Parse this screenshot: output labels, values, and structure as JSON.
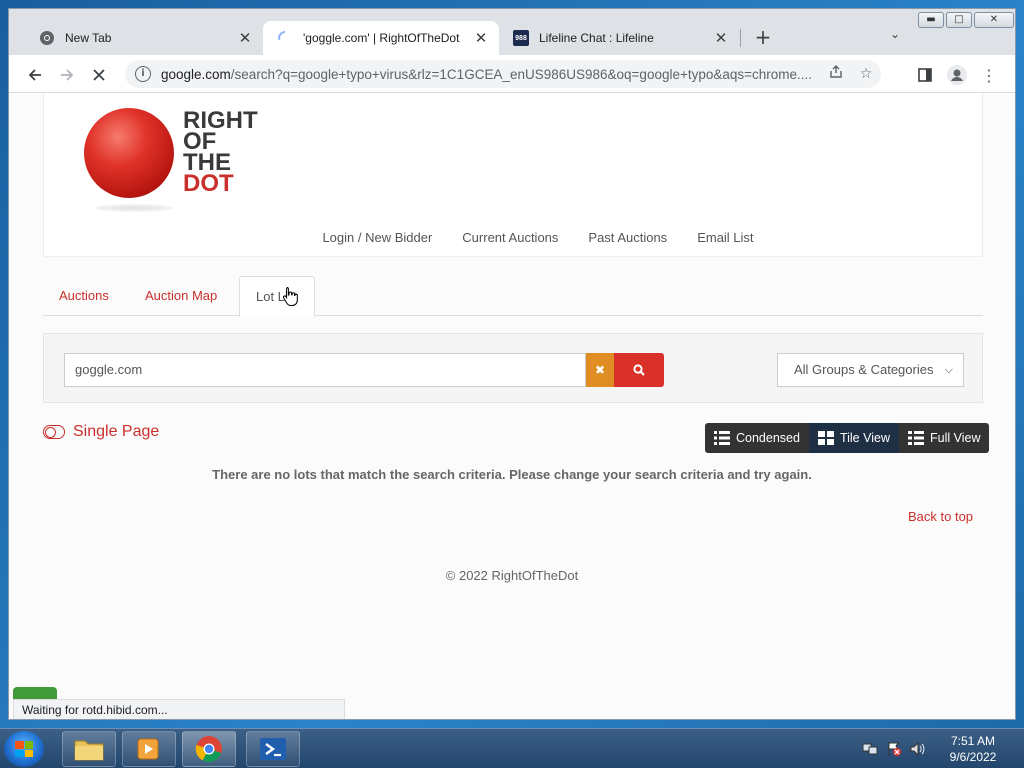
{
  "browser": {
    "tabs": [
      {
        "title": "New Tab",
        "icon": "chrome-icon",
        "active": false
      },
      {
        "title": "'goggle.com' | RightOfTheDot",
        "icon": "loading-spinner-icon",
        "active": true
      },
      {
        "title": "Lifeline Chat : Lifeline",
        "icon": "988-favicon",
        "favicon_text": "988",
        "active": false
      }
    ],
    "url_host": "google.com",
    "url_rest": "/search?q=google+typo+virus&rlz=1C1GCEA_enUS986US986&oq=google+typo&aqs=chrome....",
    "status_text": "Waiting for rotd.hibid.com..."
  },
  "site": {
    "logo_lines": [
      "RIGHT",
      "OF",
      "THE",
      "DOT"
    ],
    "nav": [
      "Login / New Bidder",
      "Current Auctions",
      "Past Auctions",
      "Email List"
    ],
    "tabs": [
      "Auctions",
      "Auction Map",
      "Lot List"
    ],
    "active_tab": "Lot List",
    "search_value": "goggle.com",
    "category_select": "All Groups & Categories",
    "single_page_label": "Single Page",
    "view_buttons": [
      "Condensed",
      "Tile View",
      "Full View"
    ],
    "active_view": "Tile View",
    "no_lots_message": "There are no lots that match the search criteria. Please change your search criteria and try again.",
    "back_to_top": "Back to top",
    "copyright": "© 2022 RightOfTheDot"
  },
  "taskbar": {
    "time": "7:51 AM",
    "date": "9/6/2022"
  },
  "colors": {
    "brand_red": "#c9302c",
    "clear_orange": "#e08e24",
    "search_red": "#d9302a"
  }
}
